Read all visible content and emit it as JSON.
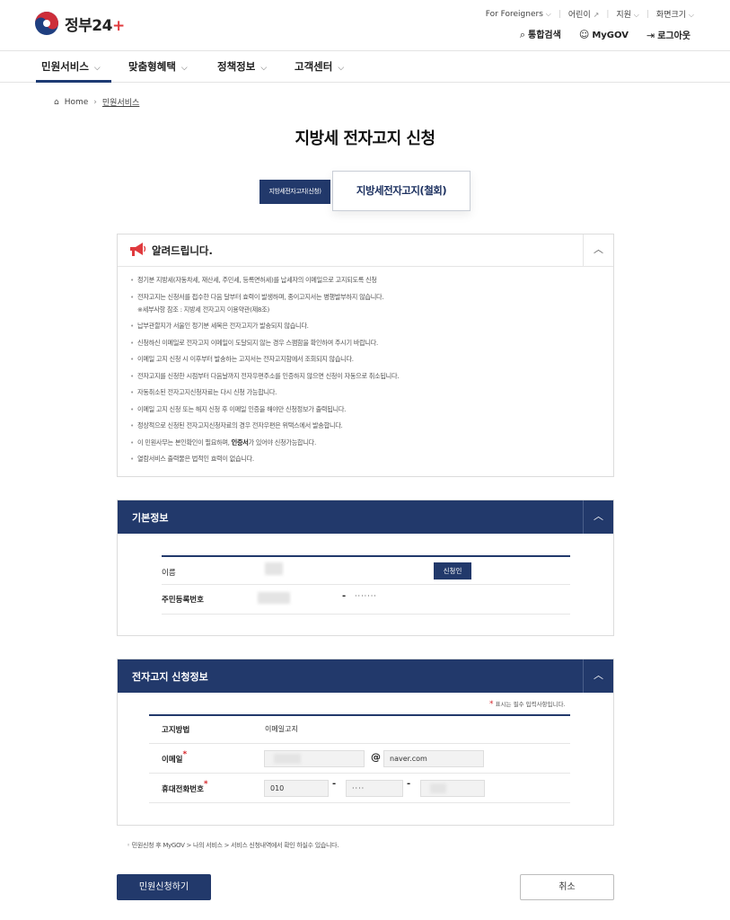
{
  "header": {
    "logo_text": "정부24",
    "logo_plus": "+",
    "util": [
      "For Foreigners",
      "어린이",
      "지원",
      "화면크기"
    ],
    "actions": {
      "search": "통합검색",
      "mygov": "MyGOV",
      "logout": "로그아웃"
    }
  },
  "gnb": [
    "민원서비스",
    "맞춤형혜택",
    "정책정보",
    "고객센터"
  ],
  "breadcrumb": {
    "home": "Home",
    "current": "민원서비스"
  },
  "page_title": "지방세 전자고지 신청",
  "tabs": {
    "apply": "지방세전자고지(신청)",
    "withdraw": "지방세전자고지(철회)"
  },
  "notice": {
    "title": "알려드립니다.",
    "items": [
      "정기분 지방세(자동차세, 재산세, 주민세, 등록면허세)를 납세자의 이메일으로 고지되도록 신청",
      "전자고지는 신청서를 접수한 다음 달부터 효력이 발생하며, 종이고지서는 병행발부하지 않습니다.",
      "납부관할지가 서울인 정기분 세목은 전자고지가 발송되지 않습니다.",
      "신청하신 이메일로 전자고지 이메일이 도달되지 않는 경우 스팸함을 확인하여 주시기 바랍니다.",
      "이메일 고지 신청 시 이후부터 발송하는 고지서는 전자고지함에서 조회되지 않습니다.",
      "전자고지를 신청한 시점부터 다음날까지 전자우편주소를 인증하지 않으면 신청이 자동으로 취소됩니다.",
      "자동취소된 전자고지신청자료는 다시 신청 가능합니다.",
      "이메일 고지 신청 또는 해지 신청 후 이메일 인증을 해야만 신청정보가 출력됩니다.",
      "정상적으로 신청된 전자고지신청자료의 경우 전자우편은 위택스에서 발송합니다.",
      "이 민원사무는 본인확인이 필요하며, 인증서가 있어야 신청가능합니다.",
      "열람서비스 출력물은 법적인 효력이 없습니다."
    ],
    "sub_note": "※세부사항 참조 : 지방세 전자고지 이용약관(제8조)",
    "cert_word": "인증서"
  },
  "basic": {
    "title": "기본정보",
    "name_label": "이름",
    "applicant_btn": "신청인",
    "rrn_label": "주민등록번호",
    "rrn_dash": "-",
    "rrn_masked": "·······"
  },
  "apply_info": {
    "title": "전자고지 신청정보",
    "req_note": "표시는 필수 입력사항입니다.",
    "method_label": "고지방법",
    "method_value": "이메일고지",
    "email_label": "이메일",
    "email_at": "@",
    "email_domain": "naver.com",
    "phone_label": "휴대전화번호",
    "phone_first": "010",
    "phone_mid": "····",
    "dash": "-"
  },
  "footnote": "민원신청 후 MyGOV > 나의 서비스 > 서비스 신청내역에서 확인 하실수 있습니다.",
  "buttons": {
    "submit": "민원신청하기",
    "cancel": "취소"
  },
  "colors": {
    "primary": "#22396b",
    "required": "#d6262b",
    "logo_red": "#e03a3e"
  }
}
